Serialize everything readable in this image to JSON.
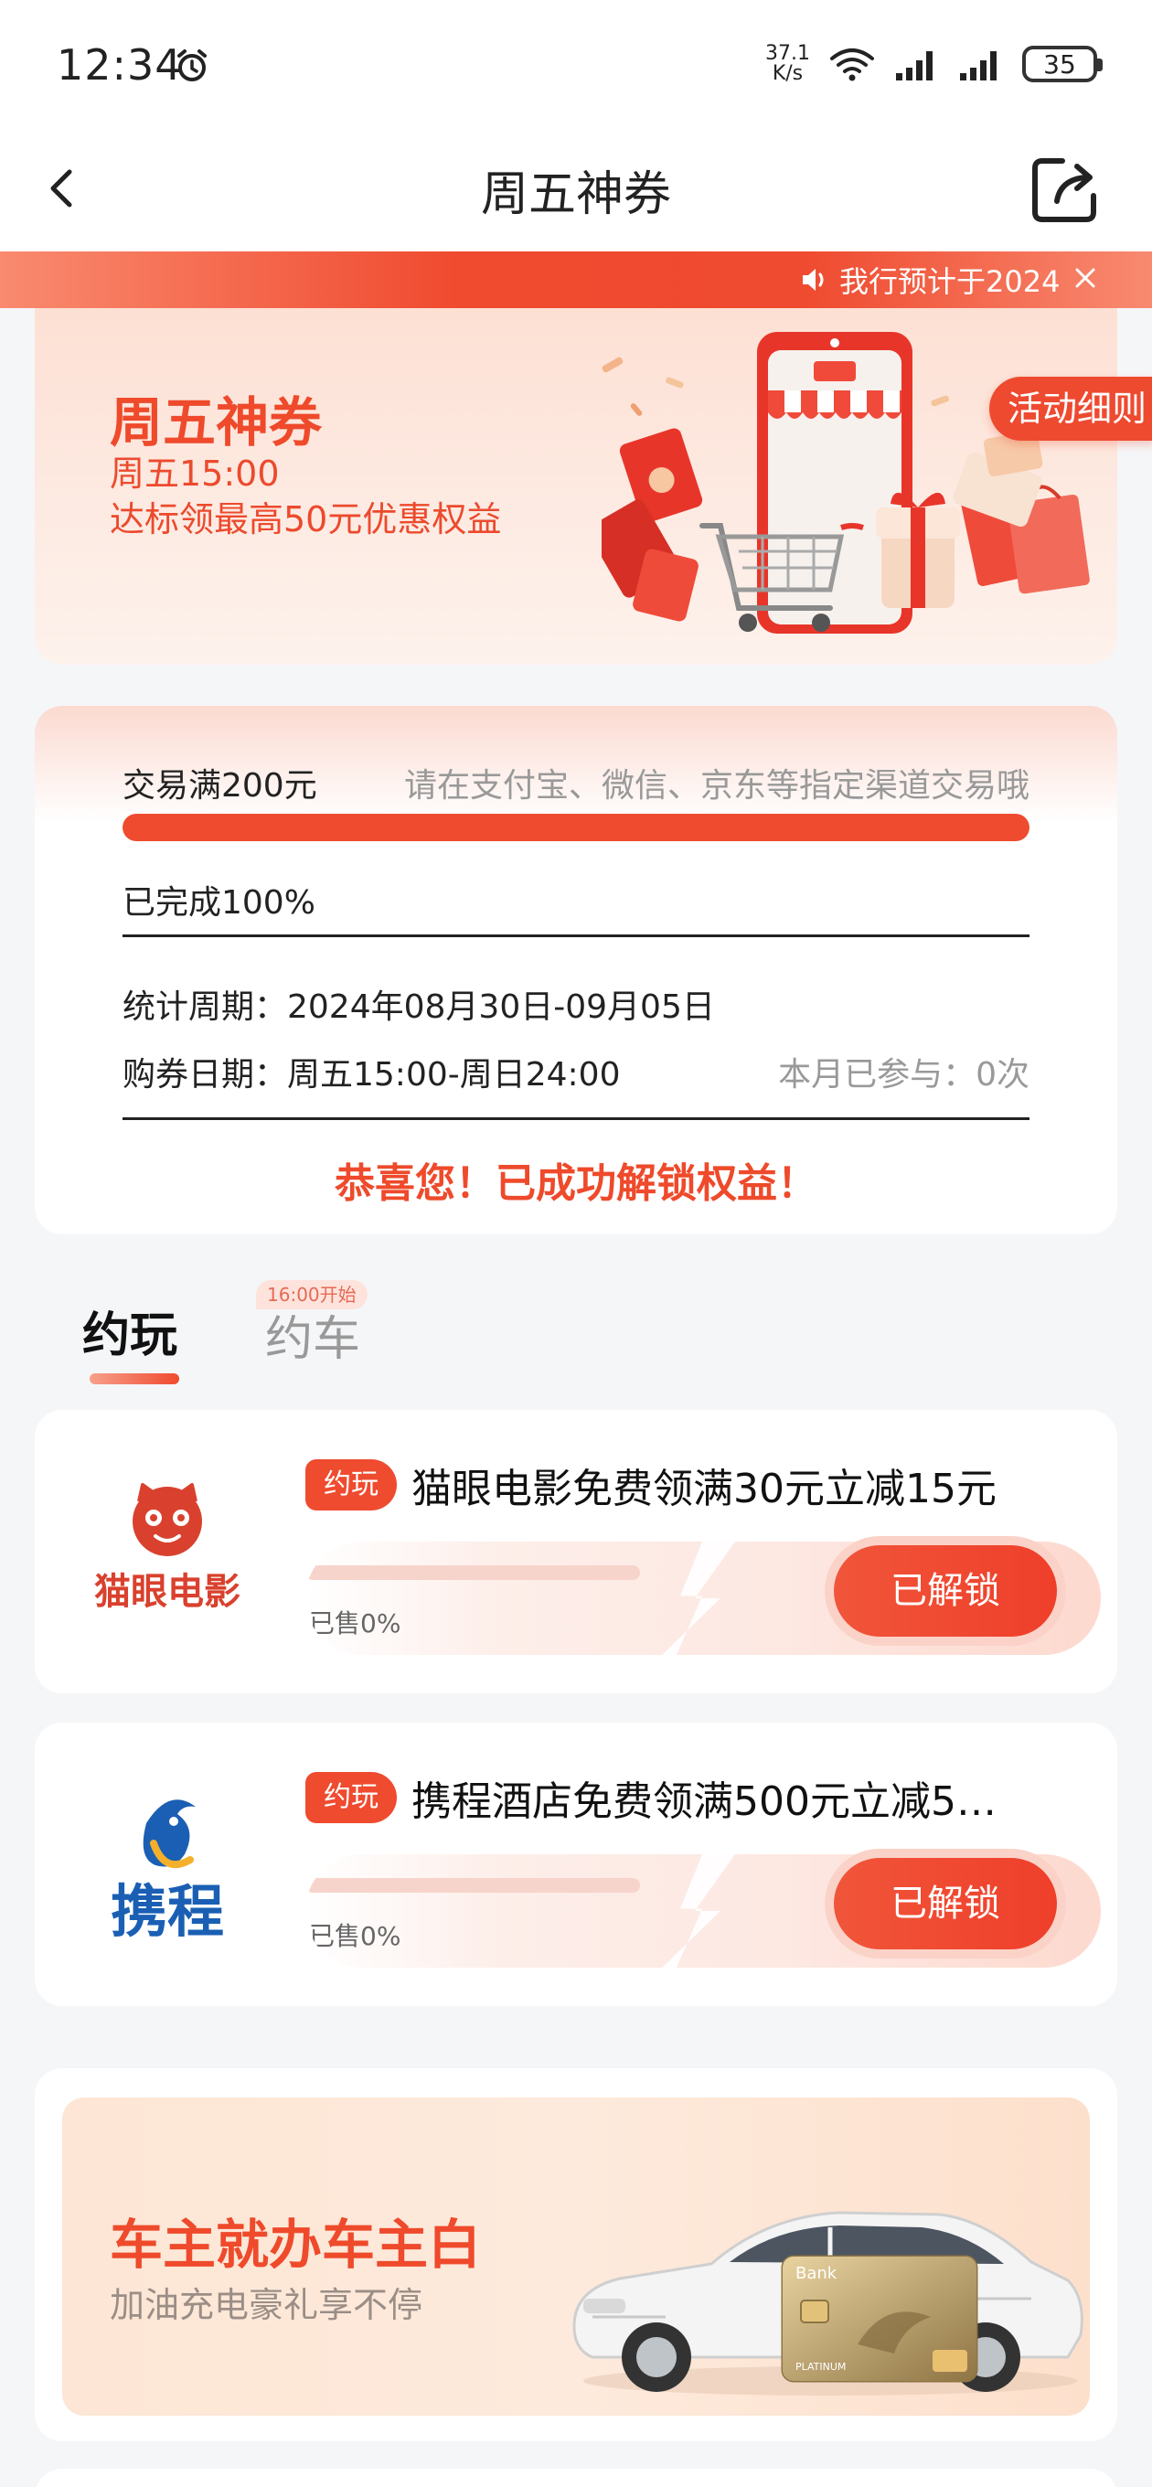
{
  "status_bar": {
    "time": "12:34",
    "net_speed_value": "37.1",
    "net_speed_unit": "K/s",
    "battery": "35"
  },
  "nav": {
    "title": "周五神券"
  },
  "notice": {
    "text": "我行预计于2024"
  },
  "banner": {
    "title": "周五神券",
    "line1": "周五15:00",
    "line2": "达标领最高50元优惠权益",
    "rules_label": "活动细则"
  },
  "progress": {
    "target_label": "交易满200元",
    "hint": "请在支付宝、微信、京东等指定渠道交易哦",
    "completed_label": "已完成100%",
    "completed_fraction": 1.0,
    "period": "统计周期：2024年08月30日-09月05日",
    "purchase": "购券日期：周五15:00-周日24:00",
    "participated": "本月已参与：0次",
    "congrats": "恭喜您！已成功解锁权益！"
  },
  "tabs": {
    "items": [
      {
        "label": "约玩",
        "active": true
      },
      {
        "label": "约车",
        "active": false,
        "badge": "16:00开始"
      }
    ]
  },
  "coupons": [
    {
      "brand": "猫眼电影",
      "tag": "约玩",
      "name": "猫眼电影免费领满30元立减15元",
      "sold": "已售0%",
      "sold_fraction": 0,
      "button": "已解锁",
      "brand_color": "#d9412e"
    },
    {
      "brand": "携程",
      "tag": "约玩",
      "name": "携程酒店免费领满500元立减5…",
      "sold": "已售0%",
      "sold_fraction": 0,
      "button": "已解锁",
      "brand_color": "#1a5fb4"
    }
  ],
  "car_banner": {
    "title": "车主就办车主白",
    "subtitle": "加油充电豪礼享不停",
    "card_text": "Bank",
    "card_tier": "PLATINUM"
  },
  "colors": {
    "accent": "#ef4b2f",
    "text": "#222222",
    "muted": "#999999"
  }
}
